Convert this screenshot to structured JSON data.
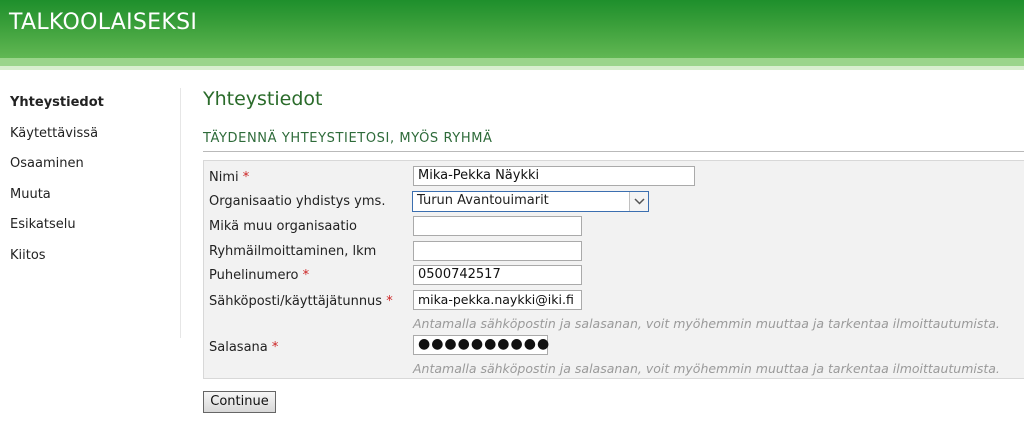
{
  "header": {
    "site_title": "TALKOOLAISEKSI"
  },
  "sidebar": {
    "items": [
      {
        "label": "Yhteystiedot",
        "active": true
      },
      {
        "label": "Käytettävissä"
      },
      {
        "label": "Osaaminen"
      },
      {
        "label": "Muuta"
      },
      {
        "label": "Esikatselu"
      },
      {
        "label": "Kiitos"
      }
    ]
  },
  "main": {
    "title": "Yhteystiedot",
    "section_title": "TÄYDENNÄ YHTEYSTIETOSI, MYÖS RYHMÄ",
    "fields": {
      "name": {
        "label": "Nimi",
        "required": "*",
        "value": "Mika-Pekka Näykki"
      },
      "organization": {
        "label": "Organisaatio yhdistys yms.",
        "value": "Turun Avantouimarit"
      },
      "other_org": {
        "label": "Mikä muu organisaatio",
        "value": ""
      },
      "group_count": {
        "label": "Ryhmäilmoittaminen, lkm",
        "value": ""
      },
      "phone": {
        "label": "Puhelinumero",
        "required": "*",
        "value": "0500742517"
      },
      "email": {
        "label": "Sähköposti/käyttäjätunnus",
        "required": "*",
        "value": "mika-pekka.naykki@iki.fi",
        "hint": "Antamalla sähköpostin ja salasanan, voit myöhemmin muuttaa ja tarkentaa ilmoittautumista."
      },
      "password": {
        "label": "Salasana",
        "required": "*",
        "value": "●●●●●●●●●●",
        "hint": "Antamalla sähköpostin ja salasanan, voit myöhemmin muuttaa ja tarkentaa ilmoittautumista."
      }
    },
    "continue_label": "Continue"
  },
  "colors": {
    "brand_green": "#3a9f3a",
    "title_green": "#2a6b2a",
    "required_red": "#cc2222"
  },
  "icons": {
    "select_arrow": "chevron-down-icon"
  }
}
